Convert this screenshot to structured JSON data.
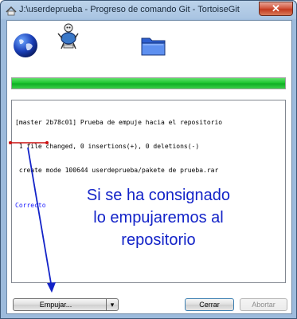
{
  "window": {
    "title": "J:\\userdeprueba - Progreso de comando Git - TortoiseGit",
    "close_glyph": "✕"
  },
  "icons": {
    "app": "tortoisegit-app-icon",
    "globe": "globe-icon",
    "robot": "tortoise-robot-icon",
    "folder": "folder-icon"
  },
  "progress": {
    "value_percent": 100,
    "color": "#17c42b"
  },
  "log": {
    "lines": [
      "[master 2b78c01] Prueba de empuje hacia el repositorio",
      " 1 file changed, 0 insertions(+), 0 deletions(-)",
      " create mode 100644 userdeprueba/pakete de prueba.rar"
    ],
    "status": "Correcto",
    "status_color": "#1a1aff"
  },
  "annotation": {
    "lines": [
      "Si se ha consignado",
      "lo empujaremos al",
      "repositorio"
    ],
    "color": "#1323c8"
  },
  "buttons": {
    "push": "Empujar...",
    "push_dropdown": "▾",
    "close": "Cerrar",
    "abort": "Abortar"
  }
}
